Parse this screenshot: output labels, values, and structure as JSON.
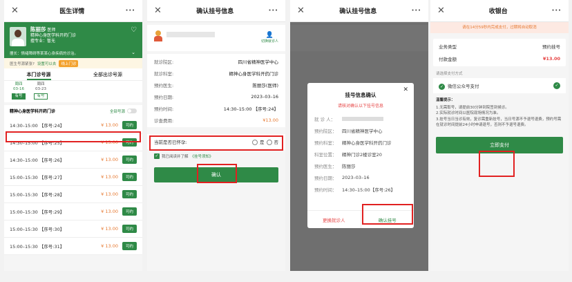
{
  "s1": {
    "title": "医生详情",
    "doctor_name": "陈丽莎",
    "doctor_title": "医师",
    "dept": "精神心身医学科开药门诊",
    "specialty": "擅专业：暂无",
    "note": "擅长：情绪障碍等某某心身疾病的诊治。",
    "hint": "医生号源紧张?",
    "hint_link": "设置可以去",
    "hint_tag": "线上门诊",
    "tab1": "本门诊号源",
    "tab2": "全部出诊号源",
    "dates": [
      {
        "day": "周四",
        "date": "03-16",
        "badge": "有号"
      },
      {
        "day": "周四",
        "date": "03-23",
        "badge": "有号"
      }
    ],
    "section": "精神心身医学科开药门诊",
    "filter": "全部号源",
    "slots": [
      {
        "time": "14:30–15:00 【序号:24】",
        "price": "¥ 13.00",
        "btn": "可约"
      },
      {
        "time": "14:30–15:00 【序号:25】",
        "price": "¥ 13.00",
        "btn": "可约"
      },
      {
        "time": "14:30–15:00 【序号:26】",
        "price": "¥ 13.00",
        "btn": "可约"
      },
      {
        "time": "15:00–15:30 【序号:27】",
        "price": "¥ 13.00",
        "btn": "可约"
      },
      {
        "time": "15:00–15:30 【序号:28】",
        "price": "¥ 13.00",
        "btn": "可约"
      },
      {
        "time": "15:00–15:30 【序号:29】",
        "price": "¥ 13.00",
        "btn": "可约"
      },
      {
        "time": "15:00–15:30 【序号:30】",
        "price": "¥ 13.00",
        "btn": "可约"
      },
      {
        "time": "15:00–15:30 【序号:31】",
        "price": "¥ 13.00",
        "btn": "可约"
      }
    ]
  },
  "s2": {
    "title": "确认挂号信息",
    "switch": "切换就诊人",
    "rows": [
      {
        "k": "就诊院区:",
        "v": "四川省精神医学中心"
      },
      {
        "k": "就诊科室:",
        "v": "精神心身医学科开药门诊"
      },
      {
        "k": "预约医生:",
        "v": "陈丽莎(医师)"
      },
      {
        "k": "预约日期:",
        "v": "2023–03–16"
      },
      {
        "k": "预约时间:",
        "v": "14:30–15:00 【序号:24】"
      },
      {
        "k": "诊查费用:",
        "v": "¥13.00"
      }
    ],
    "preg_q": "当前是否已怀孕:",
    "yes": "是",
    "no": "否",
    "agree": "我已阅读并了解",
    "agree_link": "《挂号须知》",
    "confirm": "确认"
  },
  "s3": {
    "title": "确认挂号信息",
    "dlg_title": "挂号信息确认",
    "dlg_warn": "请核对确认以下挂号信息",
    "rows": [
      {
        "k": "就 诊 人：",
        "v": ""
      },
      {
        "k": "预约院区：",
        "v": "四川省精神医学中心"
      },
      {
        "k": "预约科室：",
        "v": "精神心身医学科开药门诊"
      },
      {
        "k": "科室位置：",
        "v": "精神门诊2楼诊室20"
      },
      {
        "k": "预约医生：",
        "v": "陈丽莎"
      },
      {
        "k": "预约日期：",
        "v": "2023–03–16"
      },
      {
        "k": "预约时间：",
        "v": "14:30–15:00【序号:26】"
      }
    ],
    "change": "更换就诊人",
    "confirm": "确认挂号"
  },
  "s4": {
    "title": "收银台",
    "warn": "请在14分59秒内完成支付，过期将自动取消",
    "type_k": "业务类型",
    "type_v": "预约挂号",
    "amt_k": "付款金额",
    "amt_v": "¥13.00",
    "method_lbl": "请选择支付方式",
    "method": "微信公众号支付",
    "tips_title": "温馨提示：",
    "tips": [
      "1.无需取号，请提前30分钟到院签到候诊。",
      "2.实际就诊时间以医院现场情况为准。",
      "3.挂号当日当诊有效，复诊需重新挂号，当日号源不予退号退费，预约号需在就诊时间提前24小时申请退号，否则不予退号退费。"
    ],
    "pay": "立即支付"
  },
  "icons": {
    "close": "close-icon",
    "more": "more-icon",
    "heart": "heart-icon"
  },
  "colors": {
    "accent": "#2f8a47",
    "price": "#e6772e",
    "highlight": "#e12020"
  }
}
